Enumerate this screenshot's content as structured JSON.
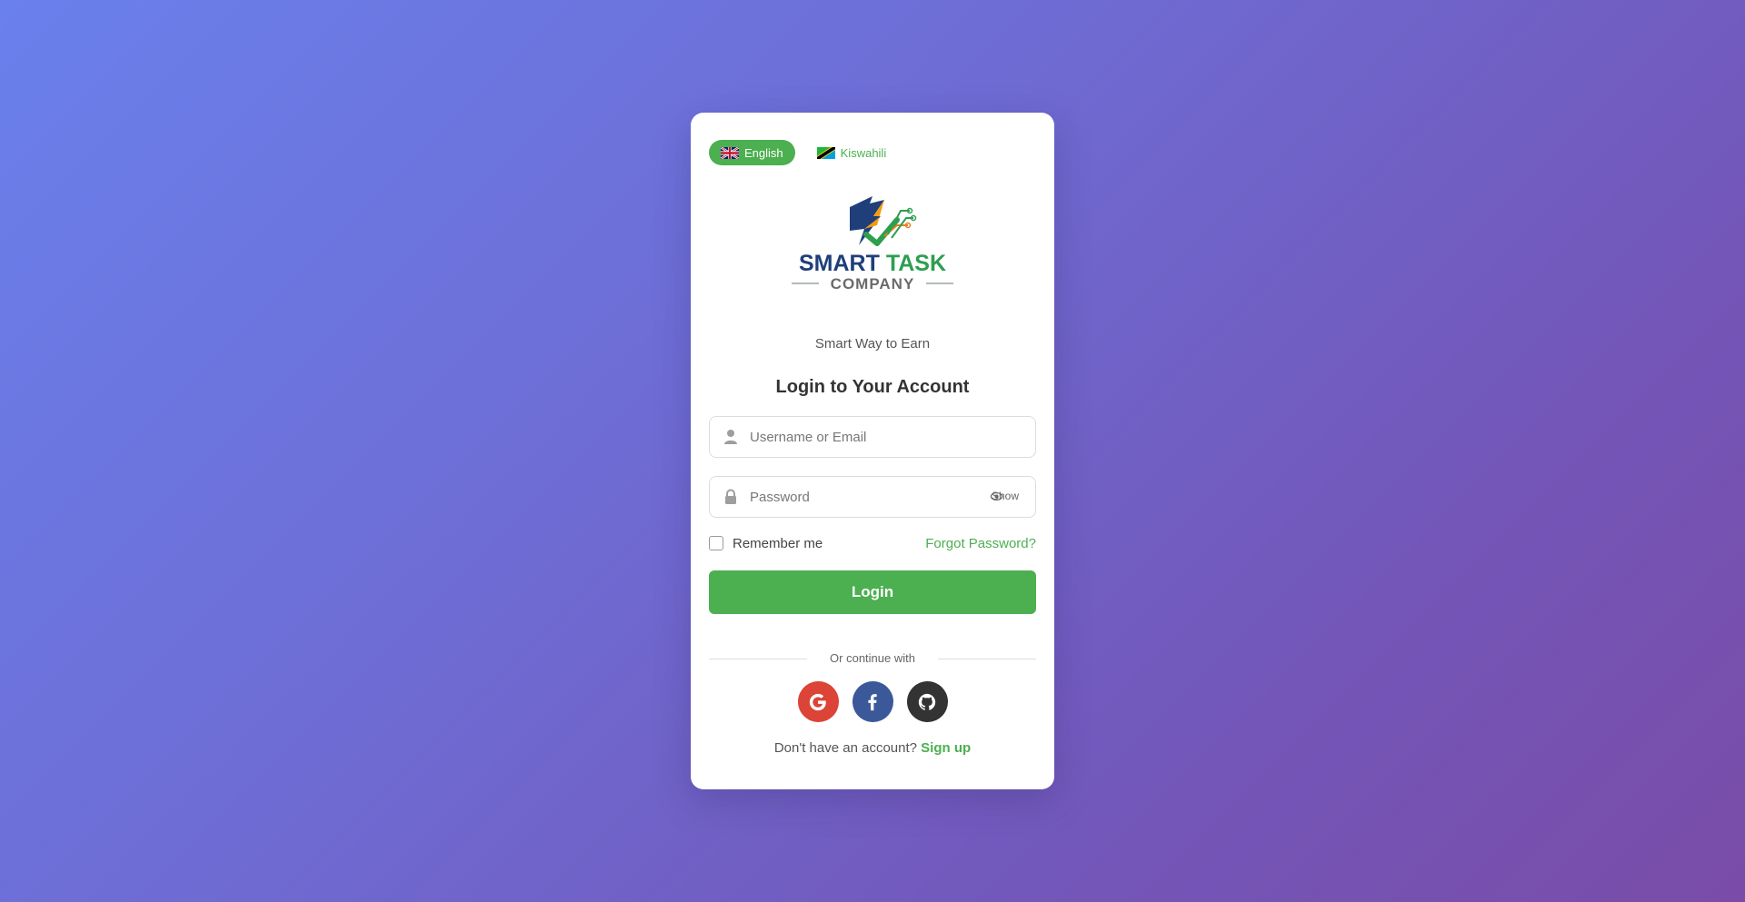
{
  "languages": {
    "english": {
      "label": "English",
      "flag": "uk-flag-icon"
    },
    "kiswahili": {
      "label": "Kiswahili",
      "flag": "tanzania-flag-icon"
    }
  },
  "brand": {
    "name_line1": "SMART TASK",
    "name_line2": "COMPANY",
    "tagline": "Smart Way to Earn"
  },
  "form": {
    "title": "Login to Your Account",
    "username_placeholder": "Username or Email",
    "password_placeholder": "Password",
    "show_label": "Show",
    "remember_label": "Remember me",
    "forgot_label": "Forgot Password?",
    "login_label": "Login"
  },
  "social": {
    "divider_text": "Or continue with",
    "providers": [
      "google-icon",
      "facebook-icon",
      "github-icon"
    ]
  },
  "signup": {
    "prompt": "Don't have an account?",
    "link": "Sign up"
  },
  "colors": {
    "accent": "#4caf50",
    "google": "#db4437",
    "facebook": "#3b5998",
    "github": "#333333"
  }
}
